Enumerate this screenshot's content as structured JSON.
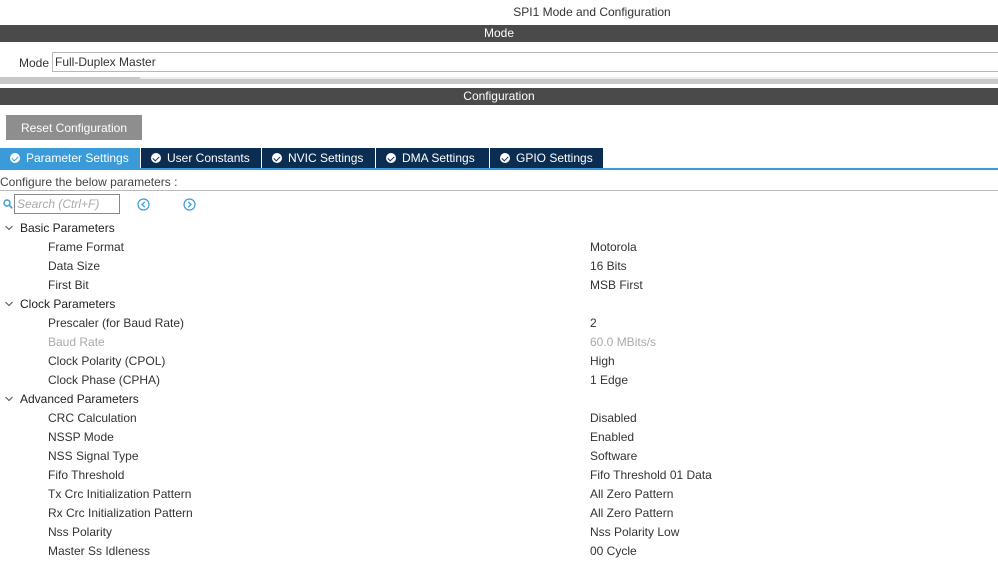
{
  "window_title": "SPI1 Mode and Configuration",
  "mode_section": {
    "header": "Mode",
    "label": "Mode",
    "value": "Full-Duplex Master"
  },
  "config_section": {
    "header": "Configuration",
    "reset_label": "Reset Configuration"
  },
  "tabs": [
    {
      "label": "Parameter Settings",
      "active": true
    },
    {
      "label": "User Constants",
      "active": false
    },
    {
      "label": "NVIC Settings",
      "active": false
    },
    {
      "label": "DMA Settings",
      "active": false
    },
    {
      "label": "GPIO Settings",
      "active": false
    }
  ],
  "configure_text": "Configure the below parameters :",
  "search": {
    "placeholder": "Search (Ctrl+F)"
  },
  "groups": [
    {
      "name": "Basic Parameters",
      "params": [
        {
          "name": "Frame Format",
          "value": "Motorola"
        },
        {
          "name": "Data Size",
          "value": "16 Bits"
        },
        {
          "name": "First Bit",
          "value": "MSB First"
        }
      ]
    },
    {
      "name": "Clock Parameters",
      "params": [
        {
          "name": "Prescaler (for Baud Rate)",
          "value": "2"
        },
        {
          "name": "Baud Rate",
          "value": "60.0 MBits/s",
          "disabled": true
        },
        {
          "name": "Clock Polarity (CPOL)",
          "value": "High"
        },
        {
          "name": "Clock Phase (CPHA)",
          "value": "1 Edge"
        }
      ]
    },
    {
      "name": "Advanced Parameters",
      "params": [
        {
          "name": "CRC Calculation",
          "value": "Disabled"
        },
        {
          "name": "NSSP Mode",
          "value": "Enabled"
        },
        {
          "name": "NSS Signal Type",
          "value": "Software"
        },
        {
          "name": "Fifo Threshold",
          "value": "Fifo Threshold 01 Data"
        },
        {
          "name": "Tx Crc Initialization Pattern",
          "value": "All Zero Pattern"
        },
        {
          "name": "Rx Crc Initialization Pattern",
          "value": "All Zero Pattern"
        },
        {
          "name": "Nss Polarity",
          "value": "Nss Polarity Low"
        },
        {
          "name": "Master Ss Idleness",
          "value": "00 Cycle"
        }
      ]
    }
  ],
  "colors": {
    "section_bar": "#4a4a4a",
    "tab_active": "#3a9bd8",
    "tab_inactive": "#0b2d52",
    "reset_button": "#8e8e8e",
    "nav_icon": "#3a9bd8"
  }
}
